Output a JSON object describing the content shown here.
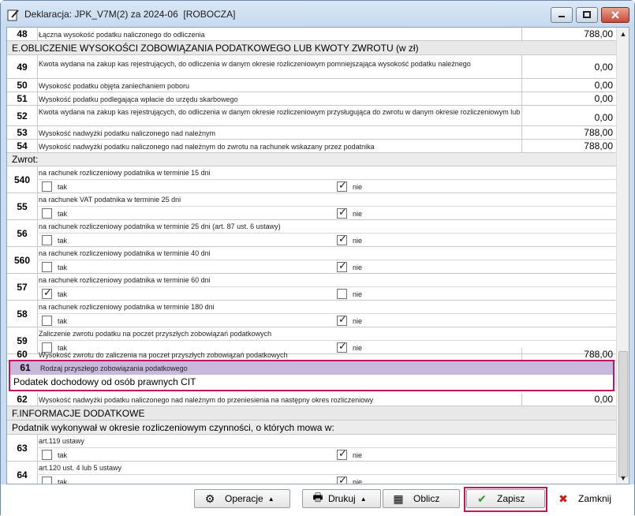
{
  "window": {
    "title": "Deklaracja: JPK_V7M(2) za 2024-06  [ROBOCZA]"
  },
  "rows": [
    {
      "num": "48",
      "label": "Łączna wysokość podatku naliczonego do odliczenia",
      "value": "788,00"
    },
    {
      "num": "49",
      "label": "Kwota wydana na zakup kas rejestrujących, do odliczenia w danym okresie rozliczeniowym pomniejszająca wysokość podatku należnego",
      "value": "0,00"
    },
    {
      "num": "50",
      "label": "Wysokość podatku objęta zaniechaniem poboru",
      "value": "0,00"
    },
    {
      "num": "51",
      "label": "Wysokość podatku podlegająca wpłacie do urzędu skarbowego",
      "value": "0,00"
    },
    {
      "num": "52",
      "label": "Kwota wydana na zakup kas rejestrujących, do odliczenia w danym okresie rozliczeniowym przysługująca do zwrotu w danym okresie rozliczeniowym lub",
      "value": "0,00"
    },
    {
      "num": "53",
      "label": "Wysokość nadwyżki podatku naliczonego nad należnym",
      "value": "788,00"
    },
    {
      "num": "54",
      "label": "Wysokość nadwyżki podatku naliczonego nad należnym do zwrotu na rachunek wskazany przez podatnika",
      "value": "788,00"
    }
  ],
  "section_e": "E.OBLICZENIE WYSOKOŚCI ZOBOWIĄZANIA PODATKOWEGO LUB KWOTY ZWROTU (w zł)",
  "zwrot_label": "Zwrot:",
  "zwrot_rows": [
    {
      "num": "540",
      "label": "na rachunek rozliczeniowy podatnika w terminie 15 dni",
      "tak": false,
      "nie": true
    },
    {
      "num": "55",
      "label": "na rachunek VAT podatnika w terminie 25 dni",
      "tak": false,
      "nie": true
    },
    {
      "num": "56",
      "label": "na rachunek rozliczeniowy podatnika w terminie 25 dni (art. 87 ust. 6 ustawy)",
      "tak": false,
      "nie": true
    },
    {
      "num": "560",
      "label": "na rachunek rozliczeniowy podatnika w terminie 40 dni",
      "tak": false,
      "nie": true
    },
    {
      "num": "57",
      "label": "na rachunek rozliczeniowy podatnika w terminie 60 dni",
      "tak": true,
      "nie": false
    },
    {
      "num": "58",
      "label": "na rachunek rozliczeniowy podatnika w terminie 180 dni",
      "tak": false,
      "nie": true
    },
    {
      "num": "59",
      "label": "Zaliczenie zwrotu podatku na poczet przyszłych zobowiązań podatkowych",
      "tak": false,
      "nie": true
    }
  ],
  "opt_tak": "tak",
  "opt_nie": "nie",
  "row60": {
    "num": "60",
    "label": "Wysokość zwrotu do zaliczenia na poczet przyszłych zobowiązań podatkowych",
    "value": "788,00"
  },
  "row61": {
    "num": "61",
    "label": "Rodzaj przyszłego zobowiązania podatkowego",
    "value": "Podatek dochodowy od osób prawnych CIT"
  },
  "row62": {
    "num": "62",
    "label": "Wysokość nadwyżki podatku naliczonego nad należnym do przeniesienia na następny okres rozliczeniowy",
    "value": "0,00"
  },
  "section_f": "F.INFORMACJE DODATKOWE",
  "section_f_sub": "Podatnik wykonywał w okresie rozliczeniowym czynności, o których mowa w:",
  "f_rows": [
    {
      "num": "63",
      "label": "art.119 ustawy",
      "tak": false,
      "nie": true
    },
    {
      "num": "64",
      "label": "art.120 ust. 4 lub 5 ustawy",
      "tak": false,
      "nie": true
    }
  ],
  "buttons": {
    "operacje": "Operacje",
    "drukuj": "Drukuj",
    "oblicz": "Oblicz",
    "zapisz": "Zapisz",
    "zamknij": "Zamknij"
  },
  "colors": {
    "highlight": "#c0165e",
    "save_check": "#2a9a2a",
    "close_x": "#cc1a1a"
  }
}
